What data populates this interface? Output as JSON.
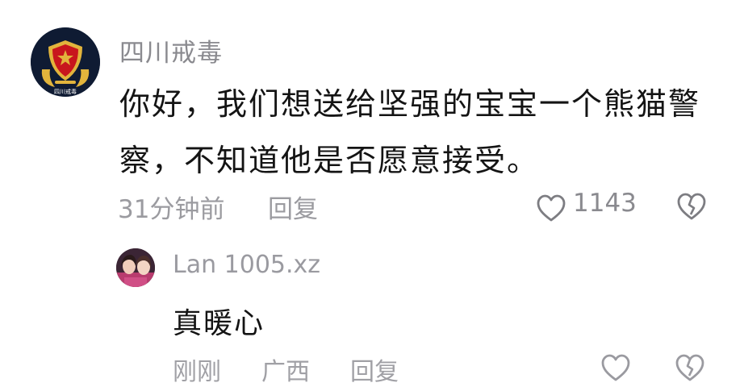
{
  "comment": {
    "author": "四川戒毒",
    "text": "你好，我们想送给坚强的宝宝一个熊猫警察，不知道他是否愿意接受。",
    "time": "31分钟前",
    "reply_label": "回复",
    "likes": "1143",
    "avatar_icon": "police-emblem-icon",
    "avatar_seal_text": "四川戒毒"
  },
  "reply": {
    "author": "Lan 1005.xz",
    "text": "真暖心",
    "time": "刚刚",
    "location": "广西",
    "reply_label": "回复",
    "avatar_icon": "user-photo-avatar"
  },
  "colors": {
    "author_gray": "#8a8a8f",
    "text_black": "#141414",
    "emblem_red": "#c8161d",
    "emblem_gold": "#e2b43c",
    "avatar_navy": "#0f1b33"
  }
}
